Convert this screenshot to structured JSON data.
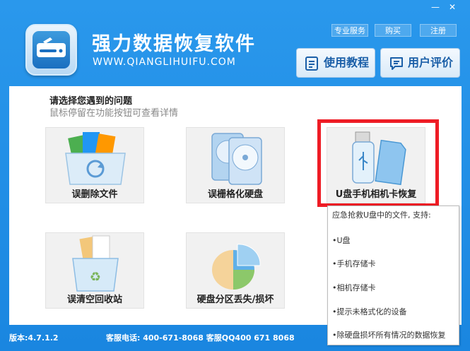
{
  "window": {
    "minimize_glyph": "—",
    "close_glyph": "✕"
  },
  "header": {
    "title": "强力数据恢复软件",
    "url": "WWW.QIANGLIHUIFU.COM",
    "top_links": [
      "专业服务",
      "购买",
      "注册"
    ],
    "tutorial_label": "使用教程",
    "review_label": "用户评价"
  },
  "content": {
    "prompt": "请选择您遇到的问题",
    "hint": "鼠标停留在功能按钮可查看详情",
    "tiles": [
      {
        "label": "误删除文件",
        "icon": "deleted-files-icon"
      },
      {
        "label": "误栅格化硬盘",
        "icon": "format-disk-icon"
      },
      {
        "label": "U盘手机相机卡恢复",
        "icon": "usb-card-icon"
      },
      {
        "label": "误清空回收站",
        "icon": "recycle-bin-icon"
      },
      {
        "label": "硬盘分区丢失/损坏",
        "icon": "partition-icon"
      }
    ]
  },
  "tooltip": {
    "heading": "应急抢救U盘中的文件, 支持:",
    "items": [
      "•U盘",
      "•手机存储卡",
      "•相机存储卡",
      "•提示未格式化的设备",
      "•除硬盘损坏所有情况的数据恢复"
    ]
  },
  "footer": {
    "version": "版本:4.7.1.2",
    "service": "客服电话: 400-671-8068 客服QQ400 671 8068"
  },
  "colors": {
    "header_bg": "#1e8ee6",
    "highlight": "#ee1c25",
    "button_text": "#1b5fa8"
  }
}
